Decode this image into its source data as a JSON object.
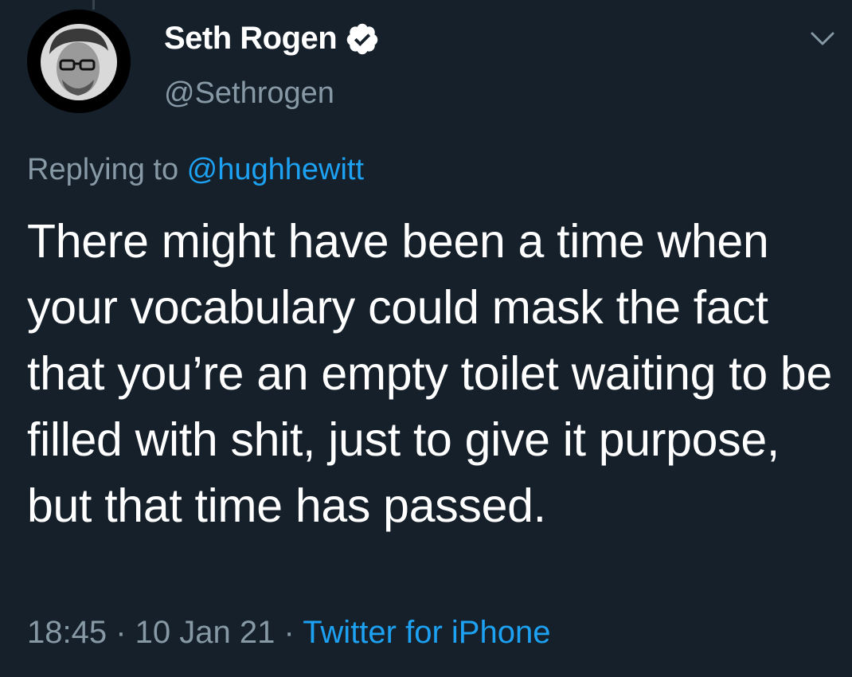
{
  "tweet": {
    "author": {
      "display_name": "Seth Rogen",
      "handle": "@Sethrogen",
      "verified": true,
      "avatar_icon": "avatar-photo"
    },
    "reply": {
      "prefix": "Replying to ",
      "mention": "@hughhewitt"
    },
    "text": "There might have been a time when your vocabulary could mask the fact that you’re an empty toilet waiting to be filled with shit, just to give it purpose, but that time has passed.",
    "time": "18:45",
    "separator": " · ",
    "date": "10 Jan 21",
    "source": "Twitter for iPhone",
    "menu_icon": "chevron-down-icon"
  },
  "colors": {
    "background": "#15202b",
    "primary_text": "#ffffff",
    "secondary_text": "#8899a6",
    "accent": "#1da1f2"
  }
}
